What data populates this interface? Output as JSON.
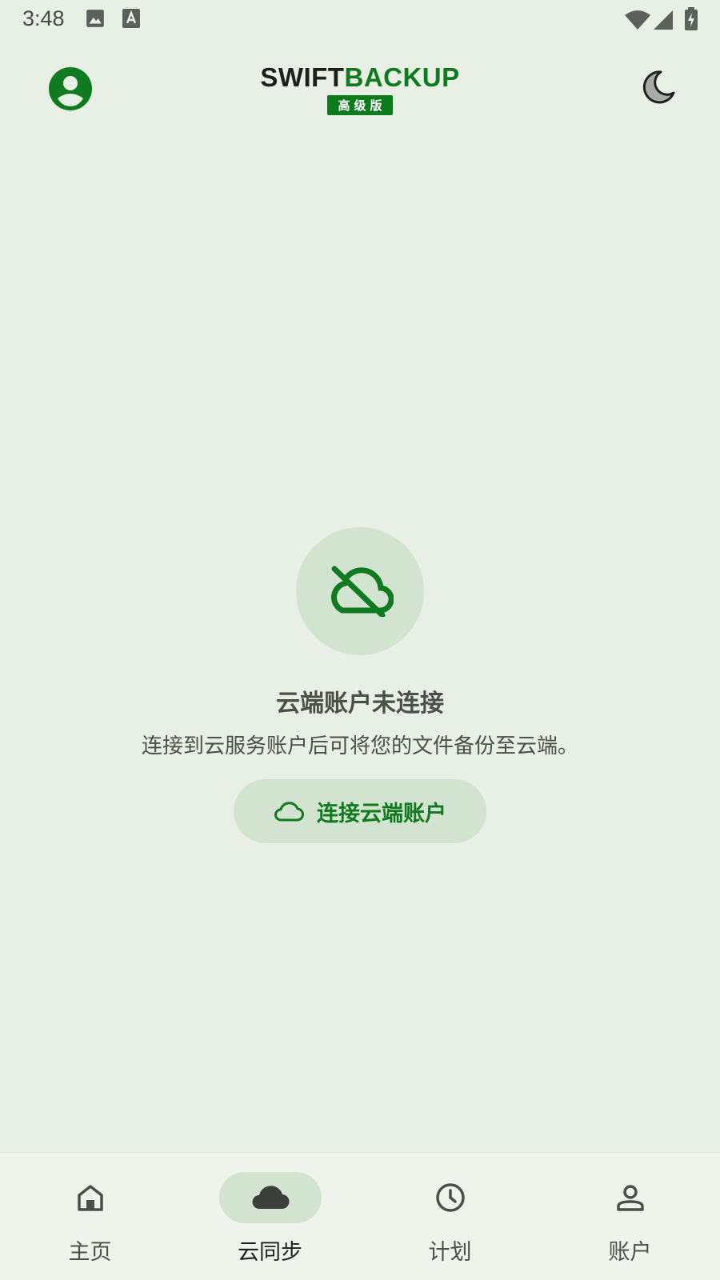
{
  "status_bar": {
    "time": "3:48",
    "icons": [
      "image-icon",
      "text-recognition-icon",
      "wifi-icon",
      "signal-icon",
      "battery-charging-icon"
    ]
  },
  "header": {
    "logo_part1": "SWIFT",
    "logo_part2": "BACKUP",
    "badge": "高级版",
    "avatar_icon": "account-circle-icon",
    "theme_icon": "moon-icon"
  },
  "empty_state": {
    "icon": "cloud-off-icon",
    "title": "云端账户未连接",
    "description": "连接到云服务账户后可将您的文件备份至云端。",
    "button_label": "连接云端账户",
    "button_icon": "cloud-outline-icon"
  },
  "bottom_nav": {
    "items": [
      {
        "label": "主页",
        "icon": "home-icon",
        "active": false
      },
      {
        "label": "云同步",
        "icon": "cloud-icon",
        "active": true
      },
      {
        "label": "计划",
        "icon": "clock-icon",
        "active": false
      },
      {
        "label": "账户",
        "icon": "person-icon",
        "active": false
      }
    ]
  },
  "colors": {
    "background": "#e8efe4",
    "accent": "#0f7a1f",
    "tonal": "#d2e4d0",
    "text": "#4a4f4a"
  }
}
